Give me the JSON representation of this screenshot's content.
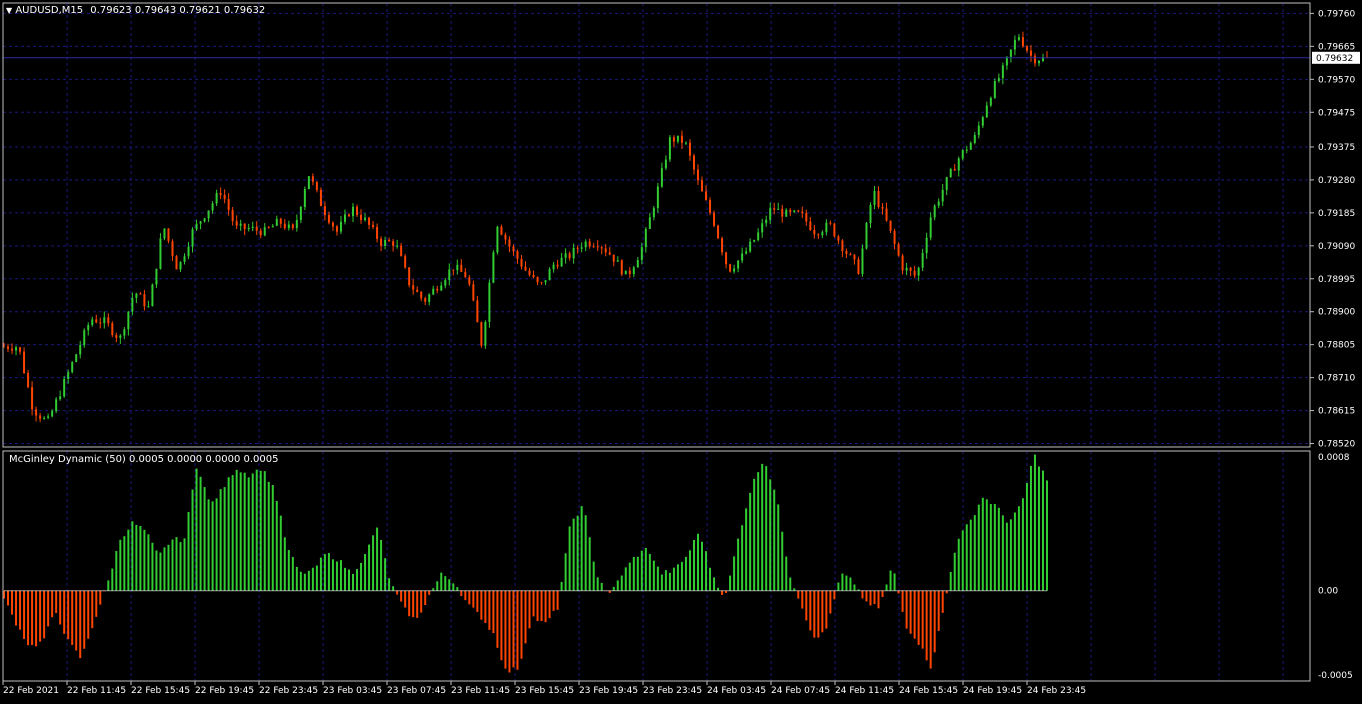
{
  "main_panel": {
    "symbol_timeframe": "AUDUSD,M15",
    "ohlc": "0.79623 0.79643 0.79621 0.79632",
    "price_labels": [
      "0.79760",
      "0.79665",
      "0.79570",
      "0.79475",
      "0.79375",
      "0.79280",
      "0.79185",
      "0.79090",
      "0.78995",
      "0.78900",
      "0.78805",
      "0.78710",
      "0.78615",
      "0.78520"
    ],
    "current_price": "0.79632"
  },
  "indicator_panel": {
    "title": "McGinley Dynamic (50) 0.0005 0.0000 0.0000 0.0005",
    "labels": [
      "0.0008",
      "0.00",
      "-0.0005"
    ]
  },
  "time_labels": [
    "22 Feb 2021",
    "22 Feb 11:45",
    "22 Feb 15:45",
    "22 Feb 19:45",
    "22 Feb 23:45",
    "23 Feb 03:45",
    "23 Feb 07:45",
    "23 Feb 11:45",
    "23 Feb 15:45",
    "23 Feb 19:45",
    "23 Feb 23:45",
    "24 Feb 03:45",
    "24 Feb 07:45",
    "24 Feb 11:45",
    "24 Feb 15:45",
    "24 Feb 19:45",
    "24 Feb 23:45"
  ],
  "colors": {
    "background": "#000000",
    "grid": "#1a1a7a",
    "frame": "#c0c0c0",
    "bull": "#32cd32",
    "bear": "#ff4500",
    "price_line": "#2a2aa0"
  },
  "chart_data": [
    {
      "type": "candlestick",
      "title": "AUDUSD,M15",
      "ylim": [
        0.7851,
        0.7979
      ],
      "x": [
        "22 Feb 2021",
        "22 Feb 11:45",
        "22 Feb 15:45",
        "22 Feb 19:45",
        "22 Feb 23:45",
        "23 Feb 03:45",
        "23 Feb 07:45",
        "23 Feb 11:45",
        "23 Feb 15:45",
        "23 Feb 19:45",
        "23 Feb 23:45",
        "24 Feb 03:45",
        "24 Feb 07:45",
        "24 Feb 11:45",
        "24 Feb 15:45",
        "24 Feb 19:45",
        "24 Feb 23:45"
      ],
      "close_trace": [
        0.788,
        0.788,
        0.7862,
        0.7858,
        0.7868,
        0.7878,
        0.7888,
        0.7887,
        0.7882,
        0.7896,
        0.7891,
        0.7915,
        0.7902,
        0.7913,
        0.7919,
        0.7925,
        0.7914,
        0.7914,
        0.7913,
        0.7916,
        0.7913,
        0.793,
        0.792,
        0.7913,
        0.792,
        0.7916,
        0.791,
        0.791,
        0.7898,
        0.7893,
        0.7898,
        0.7903,
        0.79,
        0.788,
        0.7916,
        0.7908,
        0.7902,
        0.7897,
        0.7904,
        0.7906,
        0.791,
        0.791,
        0.7906,
        0.79,
        0.7908,
        0.7923,
        0.794,
        0.7939,
        0.7926,
        0.7916,
        0.7902,
        0.7906,
        0.7912,
        0.792,
        0.7918,
        0.7918,
        0.7913,
        0.7915,
        0.7908,
        0.7902,
        0.7925,
        0.7915,
        0.7903,
        0.79,
        0.7918,
        0.7927,
        0.7935,
        0.794,
        0.7952,
        0.796,
        0.797,
        0.7963,
        0.7963
      ],
      "current_price": 0.79632
    },
    {
      "type": "bar",
      "title": "McGinley Dynamic (50)",
      "ylim": [
        -0.00053,
        0.00082
      ],
      "values_trace": [
        -5e-05,
        -0.0002,
        -0.00033,
        -0.0003,
        -0.00012,
        -0.0003,
        -0.0004,
        -0.00018,
        3e-05,
        0.0003,
        0.0004,
        0.00035,
        0.0002,
        0.0003,
        0.0003,
        0.00075,
        0.0005,
        0.0006,
        0.00072,
        0.00068,
        0.00072,
        0.0006,
        0.00025,
        0.0001,
        0.00012,
        0.00022,
        0.00018,
        0.0001,
        0.0002,
        0.00038,
        5e-05,
        -0.0001,
        -0.00018,
        -3e-05,
        0.0001,
        5e-05,
        -8e-05,
        -0.00015,
        -0.00025,
        -0.00048,
        -0.00045,
        -0.00015,
        -0.0002,
        -0.0001,
        0.0004,
        0.0005,
        0.0001,
        -3e-05,
        0.0001,
        0.0002,
        0.00025,
        0.0001,
        0.00012,
        0.0002,
        0.00035,
        0.0001,
        -5e-05,
        0.0003,
        0.0006,
        0.00078,
        0.00055,
        0.0001,
        -0.0001,
        -0.0003,
        -0.0002,
        0.0001,
        5e-05,
        -8e-05,
        -0.0001,
        0.00015,
        -0.0002,
        -0.0003,
        -0.00045,
        -0.0001,
        0.0003,
        0.0004,
        0.00055,
        0.0005,
        0.0004,
        0.0005,
        0.0008,
        0.00065
      ],
      "zero_line": 0.0
    }
  ]
}
